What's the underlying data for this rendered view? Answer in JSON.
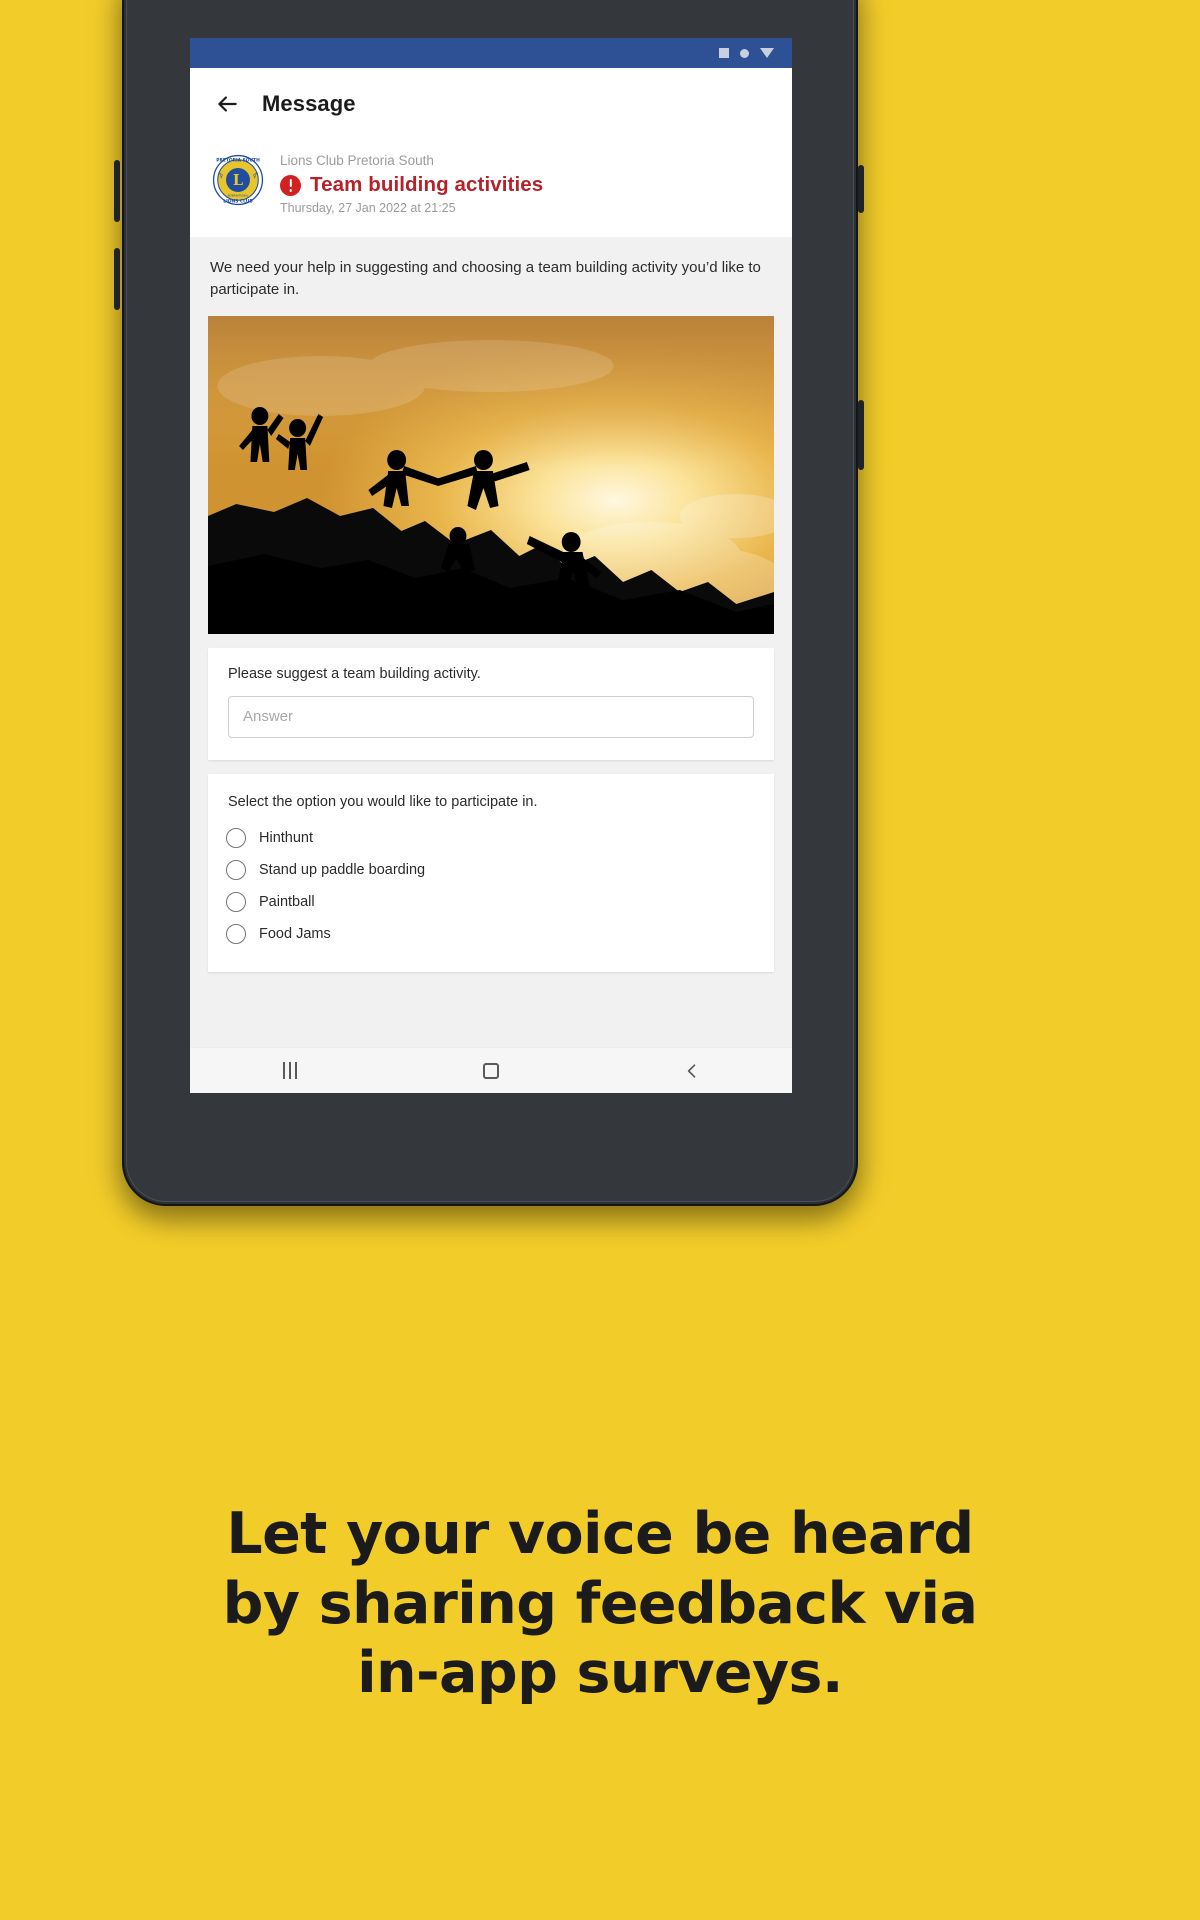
{
  "poster": {
    "background_color": "#F2CD2A",
    "caption_lines": [
      "Let your voice be heard",
      "by sharing feedback via",
      "in-app surveys."
    ]
  },
  "device": {
    "frame_color": "#2c2f33"
  },
  "statusbar": {
    "background_color": "#2e5196",
    "icons": [
      "square-icon",
      "dot-icon",
      "triangle-down-icon"
    ]
  },
  "appbar": {
    "back_icon": "arrow-left-icon",
    "title": "Message"
  },
  "message": {
    "logo_alt": "lions-club-logo",
    "sender": "Lions Club Pretoria South",
    "priority_icon": "exclamation-icon",
    "priority_color": "#D32020",
    "subject": "Team building activities",
    "subject_color": "#B5222A",
    "timestamp": "Thursday, 27 Jan 2022 at 21:25",
    "body": "We need your help in suggesting and choosing a team building activity you’d like to participate in.",
    "hero_image_alt": "team-silhouettes-helping-on-mountain-at-sunset"
  },
  "survey": {
    "text_question": {
      "label": "Please suggest a team building activity.",
      "value": "",
      "placeholder": "Answer"
    },
    "choice_question": {
      "label": "Select the option you would like to participate in.",
      "options": [
        {
          "label": "Hinthunt",
          "selected": false
        },
        {
          "label": "Stand up paddle boarding",
          "selected": false
        },
        {
          "label": "Paintball",
          "selected": false
        },
        {
          "label": "Food Jams",
          "selected": false
        }
      ]
    }
  },
  "navbar": {
    "recent_icon": "recents-icon",
    "home_icon": "home-square-icon",
    "back_icon": "chevron-left-icon"
  }
}
